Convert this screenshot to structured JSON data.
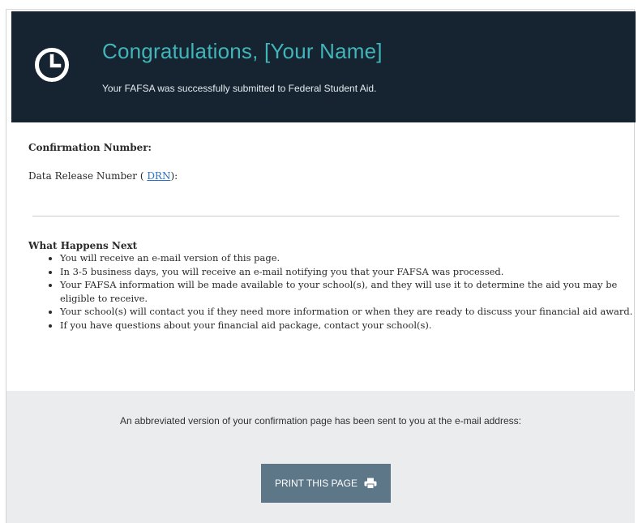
{
  "header": {
    "title": "Congratulations, [Your Name]",
    "subtitle": "Your FAFSA was successfully submitted to Federal Student Aid.",
    "icon": "clock-icon",
    "background": "#162331",
    "title_color": "#41b5b8"
  },
  "confirmation": {
    "label": "Confirmation Number:",
    "drn_prefix": "Data Release Number ( ",
    "drn_link": "DRN",
    "drn_suffix": "):"
  },
  "next": {
    "title": "What Happens Next",
    "items": [
      "You will receive an e-mail version of this page.",
      "In 3-5 business days, you will receive an e-mail notifying you that your FAFSA was processed.",
      "Your FAFSA information will be made available to your school(s), and they will use it to determine the aid you may be eligible to receive.",
      "Your school(s) will contact you if they need more information or when they are ready to discuss your financial aid award.",
      "If you have questions about your financial aid package, contact your school(s)."
    ]
  },
  "footer": {
    "message": "An abbreviated version of your confirmation page has been sent to you at the e-mail address:",
    "print_label": "PRINT THIS PAGE",
    "print_icon": "printer-icon",
    "button_color": "#5d7789"
  }
}
